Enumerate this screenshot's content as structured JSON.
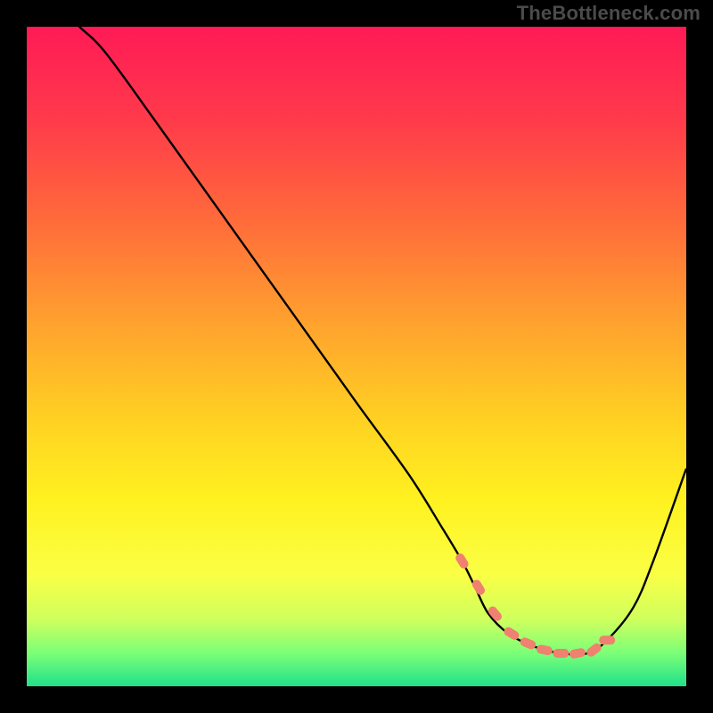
{
  "watermark": "TheBottleneck.com",
  "palette": {
    "page_bg": "#000000",
    "watermark_text": "#4b4b4b",
    "gradient_stops": [
      {
        "offset": 0.0,
        "color": "#ff1a56"
      },
      {
        "offset": 0.14,
        "color": "#ff3a4b"
      },
      {
        "offset": 0.3,
        "color": "#ff6d3a"
      },
      {
        "offset": 0.45,
        "color": "#ffa22e"
      },
      {
        "offset": 0.6,
        "color": "#ffd222"
      },
      {
        "offset": 0.72,
        "color": "#fff220"
      },
      {
        "offset": 0.83,
        "color": "#faff45"
      },
      {
        "offset": 0.9,
        "color": "#ceff5e"
      },
      {
        "offset": 0.95,
        "color": "#7bff78"
      },
      {
        "offset": 1.0,
        "color": "#20e089"
      }
    ],
    "curve_stroke": "#000000",
    "marker_fill": "#f0806f",
    "marker_stroke": "#c75c4c"
  },
  "chart_data": {
    "type": "line",
    "title": "",
    "xlabel": "",
    "ylabel": "",
    "xlim": [
      0,
      100
    ],
    "ylim": [
      0,
      100
    ],
    "grid": false,
    "legend": false,
    "series": [
      {
        "name": "bottleneck-curve",
        "x": [
          0,
          2,
          5,
          8,
          12,
          20,
          30,
          40,
          50,
          58,
          63,
          66,
          68,
          70,
          73,
          77,
          81,
          85,
          88,
          92,
          95,
          100
        ],
        "y": [
          103,
          104,
          103,
          100,
          96,
          85,
          71,
          57,
          43,
          32,
          24,
          19,
          15,
          11,
          8,
          6,
          5,
          5,
          7,
          12,
          19,
          33
        ]
      }
    ],
    "markers": {
      "name": "highlight-points",
      "x": [
        66,
        68.5,
        71,
        73.5,
        76,
        78.5,
        81,
        83.5,
        86,
        88
      ],
      "y": [
        19,
        15,
        11,
        8,
        6.5,
        5.5,
        5,
        5,
        5.5,
        7
      ]
    }
  }
}
